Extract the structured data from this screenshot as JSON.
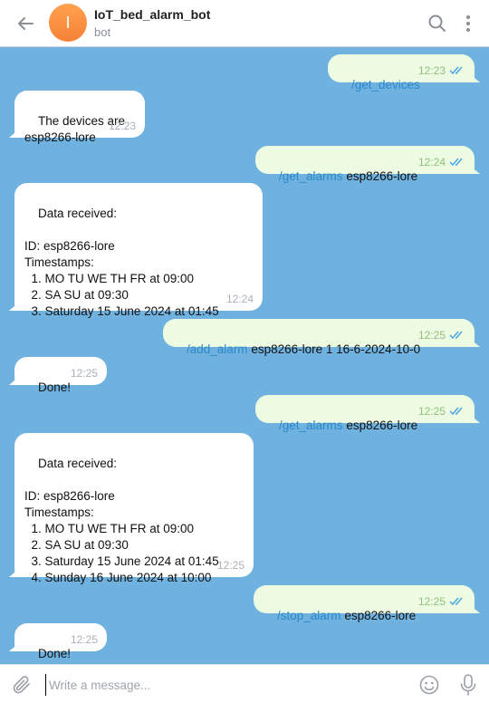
{
  "header": {
    "avatar_letter": "I",
    "title": "IoT_bed_alarm_bot",
    "subtitle": "bot",
    "icons": [
      "back-arrow-icon",
      "search-icon",
      "more-vert-icon"
    ]
  },
  "messages": [
    {
      "side": "out",
      "cmd": "/get_devices",
      "text": "",
      "time": "12:23"
    },
    {
      "side": "in",
      "text": "The devices are\nesp8266-lore",
      "time": "12:23"
    },
    {
      "side": "out",
      "cmd": "/get_alarms",
      "text": " esp8266-lore",
      "time": "12:24"
    },
    {
      "side": "in",
      "text": "Data received:\n\nID: esp8266-lore\nTimestamps:\n  1. MO TU WE TH FR at 09:00\n  2. SA SU at 09:30\n  3. Saturday 15 June 2024 at 01:45",
      "time": "12:24"
    },
    {
      "side": "out",
      "cmd": "/add_alarm",
      "text": " esp8266-lore 1 16-6-2024-10-0",
      "time": "12:25"
    },
    {
      "side": "in",
      "text": "Done!",
      "time": "12:25"
    },
    {
      "side": "out",
      "cmd": "/get_alarms",
      "text": " esp8266-lore",
      "time": "12:25"
    },
    {
      "side": "in",
      "text": "Data received:\n\nID: esp8266-lore\nTimestamps:\n  1. MO TU WE TH FR at 09:00\n  2. SA SU at 09:30\n  3. Saturday 15 June 2024 at 01:45\n  4. Sunday 16 June 2024 at 10:00",
      "time": "12:25"
    },
    {
      "side": "out",
      "cmd": "/stop_alarm",
      "text": " esp8266-lore",
      "time": "12:25"
    },
    {
      "side": "in",
      "text": "Done!",
      "time": "12:25"
    }
  ],
  "composer": {
    "placeholder": "Write a message...",
    "icons": [
      "paperclip-icon",
      "emoji-icon",
      "microphone-icon"
    ]
  },
  "colors": {
    "chat_background": "#6fb2e0",
    "incoming_bubble": "#ffffff",
    "outgoing_bubble": "#eefbe3",
    "command_link": "#2e88c7",
    "avatar": "#f68136"
  }
}
